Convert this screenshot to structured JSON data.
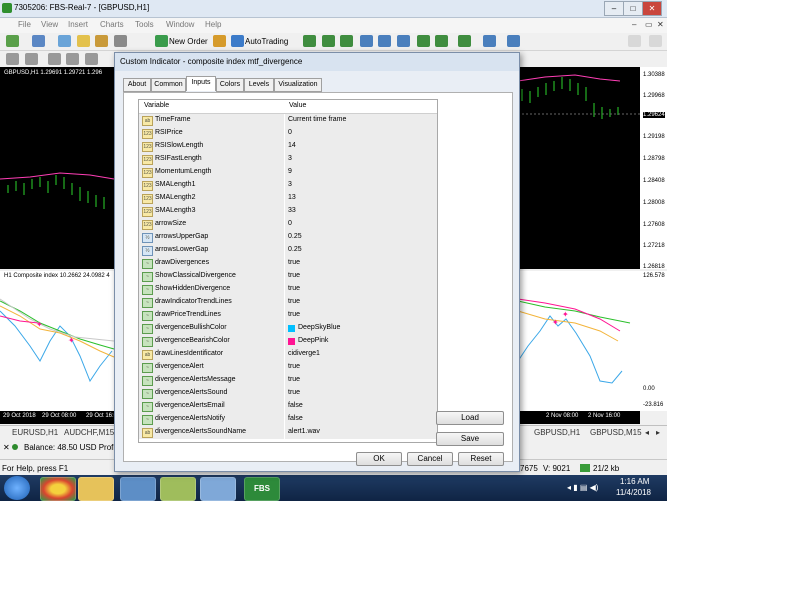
{
  "window": {
    "title": "7305206: FBS-Real-7 - [GBPUSD,H1]"
  },
  "menu": [
    "File",
    "View",
    "Insert",
    "Charts",
    "Tools",
    "Window",
    "Help"
  ],
  "toolbar": {
    "new_order": "New Order",
    "autotrading": "AutoTrading"
  },
  "chart_top": {
    "symbol_label": "GBPUSD,H1  1.29691 1.29721 1.296",
    "prices": [
      "1.30388",
      "1.29968",
      "1.29624",
      "1.29198",
      "1.28798",
      "1.28408",
      "1.28008",
      "1.27608",
      "1.27218",
      "1.26818"
    ],
    "current_price": "1.29624"
  },
  "chart_bottom": {
    "indicator_label": "H1 Composite index 10.2662 24.0982 4",
    "values": [
      "126.578",
      "0.00",
      "-23.816"
    ],
    "time_left": [
      "29 Oct 2018",
      "29 Oct 08:00",
      "29 Oct 16:00"
    ],
    "time_right": [
      "2 Nov 08:00",
      "2 Nov 16:00"
    ]
  },
  "bottom_tabs": [
    "EURUSD,H1",
    "AUDCHF,M15",
    "GBPUSD,H1",
    "GBPUSD,M15"
  ],
  "balance": "Balance: 48.50 USD  Profit/L",
  "status": {
    "help": "For Help, press F1",
    "num": "7675",
    "v": "V: 9021",
    "kb": "21/2 kb"
  },
  "clock": {
    "time": "1:16 AM",
    "date": "11/4/2018"
  },
  "dialog": {
    "title": "Custom Indicator - composite index mtf_divergence",
    "tabs": [
      "About",
      "Common",
      "Inputs",
      "Colors",
      "Levels",
      "Visualization"
    ],
    "active_tab": "Inputs",
    "col_variable": "Variable",
    "col_value": "Value",
    "rows": [
      {
        "name": "TimeFrame",
        "value": "Current time frame",
        "type": "ab"
      },
      {
        "name": "RSIPrice",
        "value": "0",
        "type": "123"
      },
      {
        "name": "RSISlowLength",
        "value": "14",
        "type": "123"
      },
      {
        "name": "RSIFastLength",
        "value": "3",
        "type": "123"
      },
      {
        "name": "MomentumLength",
        "value": "9",
        "type": "123"
      },
      {
        "name": "SMALength1",
        "value": "3",
        "type": "123"
      },
      {
        "name": "SMALength2",
        "value": "13",
        "type": "123"
      },
      {
        "name": "SMALength3",
        "value": "33",
        "type": "123"
      },
      {
        "name": "arrowSize",
        "value": "0",
        "type": "123"
      },
      {
        "name": "arrowsUpperGap",
        "value": "0.25",
        "type": "dbl"
      },
      {
        "name": "arrowsLowerGap",
        "value": "0.25",
        "type": "dbl"
      },
      {
        "name": "drawDivergences",
        "value": "true",
        "type": "bool"
      },
      {
        "name": "ShowClassicalDivergence",
        "value": "true",
        "type": "bool"
      },
      {
        "name": "ShowHiddenDivergence",
        "value": "true",
        "type": "bool"
      },
      {
        "name": "drawIndicatorTrendLines",
        "value": "true",
        "type": "bool"
      },
      {
        "name": "drawPriceTrendLines",
        "value": "true",
        "type": "bool"
      },
      {
        "name": "divergenceBullishColor",
        "value": "DeepSkyBlue",
        "type": "color",
        "color": "#00bfff"
      },
      {
        "name": "divergenceBearishColor",
        "value": "DeepPink",
        "type": "color",
        "color": "#ff1493"
      },
      {
        "name": "drawLinesIdentificator",
        "value": "cidiverge1",
        "type": "ab"
      },
      {
        "name": "divergenceAlert",
        "value": "true",
        "type": "bool"
      },
      {
        "name": "divergenceAlertsMessage",
        "value": "true",
        "type": "bool"
      },
      {
        "name": "divergenceAlertsSound",
        "value": "true",
        "type": "bool"
      },
      {
        "name": "divergenceAlertsEmail",
        "value": "false",
        "type": "bool"
      },
      {
        "name": "divergenceAlertsNotify",
        "value": "false",
        "type": "bool"
      },
      {
        "name": "divergenceAlertsSoundName",
        "value": "alert1.wav",
        "type": "ab"
      }
    ],
    "load": "Load",
    "save": "Save",
    "ok": "OK",
    "cancel": "Cancel",
    "reset": "Reset"
  }
}
